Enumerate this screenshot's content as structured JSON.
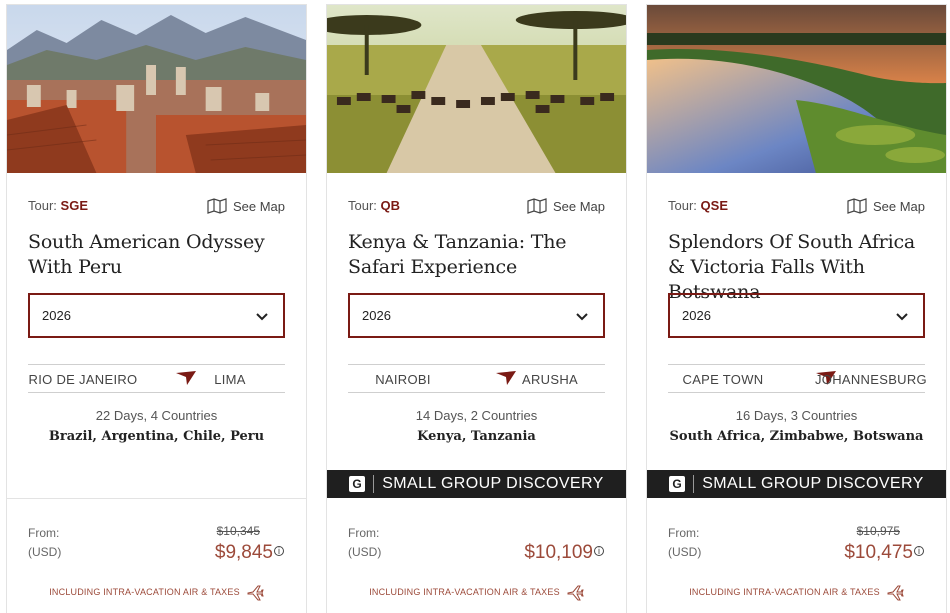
{
  "cards": [
    {
      "tour_prefix": "Tour:",
      "tour_code": "SGE",
      "see_map": "See Map",
      "title": "South American Odyssey With Peru",
      "year": "2026",
      "route_from": "RIO DE JANEIRO",
      "route_to": "LIMA",
      "days": "22 Days, 4 Countries",
      "countries": "Brazil, Argentina, Chile, Peru",
      "banner": "",
      "from_label": "From:",
      "currency": "(USD)",
      "price_old": "$10,345",
      "price": "$9,845",
      "included": "INCLUDING INTRA-VACATION AIR & TAXES"
    },
    {
      "tour_prefix": "Tour:",
      "tour_code": "QB",
      "see_map": "See Map",
      "title": "Kenya & Tanzania: The Safari Experience",
      "year": "2026",
      "route_from": "NAIROBI",
      "route_to": "ARUSHA",
      "days": "14 Days, 2 Countries",
      "countries": "Kenya, Tanzania",
      "banner": "SMALL GROUP DISCOVERY",
      "banner_logo": "G",
      "from_label": "From:",
      "currency": "(USD)",
      "price_old": "",
      "price": "$10,109",
      "included": "INCLUDING INTRA-VACATION AIR & TAXES"
    },
    {
      "tour_prefix": "Tour:",
      "tour_code": "QSE",
      "see_map": "See Map",
      "title": "Splendors Of South Africa & Victoria Falls With Botswana",
      "year": "2026",
      "route_from": "CAPE TOWN",
      "route_to": "JOHANNESBURG",
      "days": "16 Days, 3 Countries",
      "countries": "South Africa, Zimbabwe, Botswana",
      "banner": "SMALL GROUP DISCOVERY",
      "banner_logo": "G",
      "from_label": "From:",
      "currency": "(USD)",
      "price_old": "$10,975",
      "price": "$10,475",
      "included": "INCLUDING INTRA-VACATION AIR & TAXES"
    }
  ],
  "icons": {
    "map": "map-icon",
    "chevron": "chevron-down-icon",
    "route": "plane-arrow-icon",
    "info": "info-icon",
    "air": "airplane-icon"
  },
  "colors": {
    "accent": "#7a1a14",
    "price": "#9c4a3a",
    "banner_bg": "#1f1f1f"
  }
}
